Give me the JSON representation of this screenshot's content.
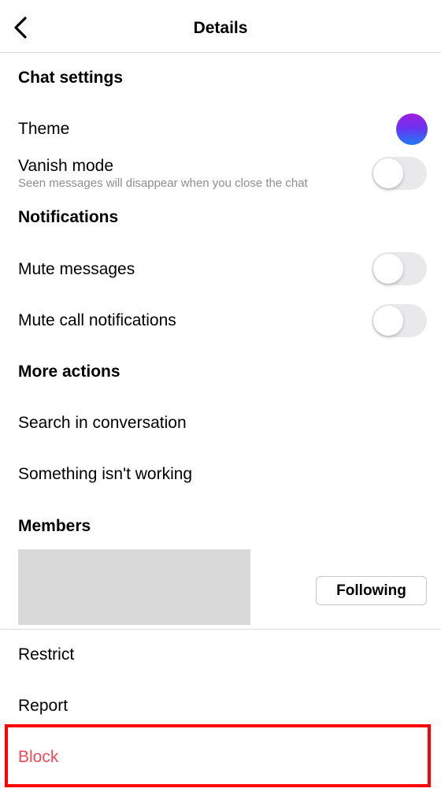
{
  "header": {
    "title": "Details"
  },
  "chat_settings": {
    "heading": "Chat settings",
    "theme_label": "Theme",
    "vanish_label": "Vanish mode",
    "vanish_sub": "Seen messages will disappear when you close the chat",
    "vanish_on": false
  },
  "notifications": {
    "heading": "Notifications",
    "mute_messages": "Mute messages",
    "mute_messages_on": false,
    "mute_calls": "Mute call notifications",
    "mute_calls_on": false
  },
  "more_actions": {
    "heading": "More actions",
    "search": "Search in conversation",
    "broken": "Something isn't working"
  },
  "members": {
    "heading": "Members",
    "following_label": "Following"
  },
  "bottom": {
    "restrict": "Restrict",
    "report": "Report",
    "block": "Block"
  },
  "colors": {
    "accent_red": "#ed4956",
    "highlight_box": "#ff0000",
    "toggle_off": "#e9e9eb"
  }
}
